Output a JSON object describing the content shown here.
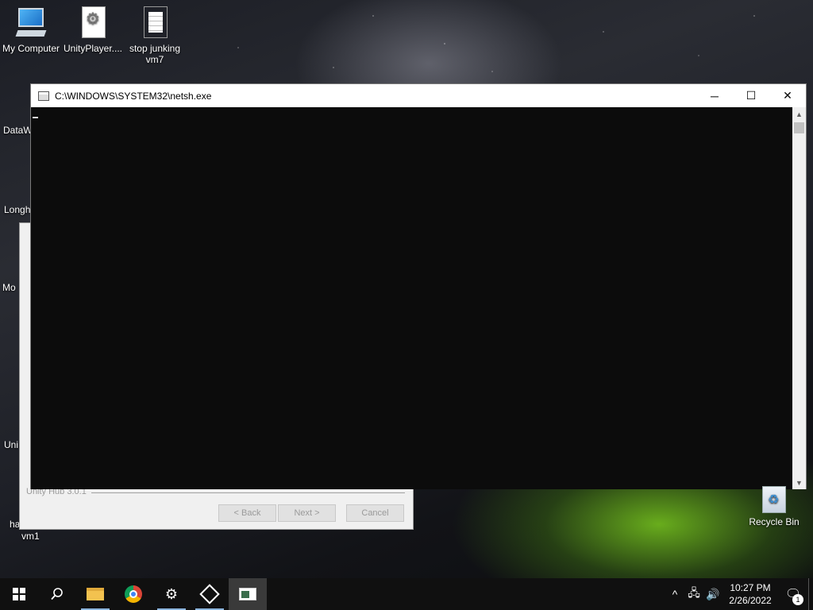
{
  "desktop": {
    "icons": [
      {
        "label": "My Computer",
        "icon": "computer-icon"
      },
      {
        "label": "UnityPlayer....",
        "icon": "settings-file-icon"
      },
      {
        "label": "stop junking vm7",
        "icon": "text-file-icon"
      }
    ],
    "partial_labels": [
      "DataW",
      "Longh",
      "Mo",
      "Uni",
      "ha",
      "vm1"
    ],
    "recycle_bin": {
      "label": "Recycle Bin",
      "icon": "recycle-bin-icon"
    }
  },
  "unity_hub_installer": {
    "version": "Unity Hub 3.0.1",
    "back_label": "< Back",
    "next_label": "Next >",
    "cancel_label": "Cancel"
  },
  "console_window": {
    "title": "C:\\WINDOWS\\SYSTEM32\\netsh.exe",
    "minimize_glyph": "─",
    "maximize_glyph": "☐",
    "close_glyph": "✕",
    "scroll_up_glyph": "▲",
    "scroll_down_glyph": "▼"
  },
  "taskbar": {
    "buttons": [
      {
        "name": "start",
        "icon": "windows-logo-icon"
      },
      {
        "name": "search",
        "icon": "search-icon"
      },
      {
        "name": "file-explorer",
        "icon": "folder-icon"
      },
      {
        "name": "chrome",
        "icon": "chrome-icon"
      },
      {
        "name": "settings",
        "icon": "gear-icon"
      },
      {
        "name": "unity",
        "icon": "unity-icon"
      },
      {
        "name": "netsh-console",
        "icon": "console-icon"
      }
    ],
    "tray": {
      "time": "10:27 PM",
      "date": "2/26/2022",
      "notification_count": "1"
    }
  }
}
